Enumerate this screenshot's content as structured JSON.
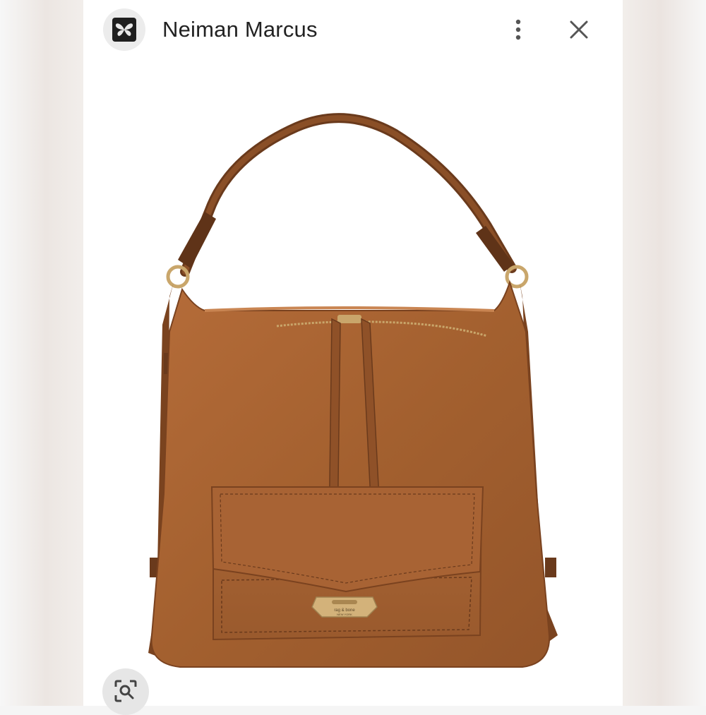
{
  "header": {
    "title": "Neiman Marcus",
    "app_icon": "butterfly-icon",
    "menu_icon": "more-vert-icon",
    "close_icon": "close-icon"
  },
  "product": {
    "image": "brown-leather-hobo-bag",
    "hardware_label_line1": "rag & bone",
    "hardware_label_line2": "NEW YORK"
  },
  "actions": {
    "lens_icon": "visual-search-icon"
  },
  "colors": {
    "leather": "#a7602f",
    "hardware": "#c9a66b",
    "text": "#222222"
  }
}
